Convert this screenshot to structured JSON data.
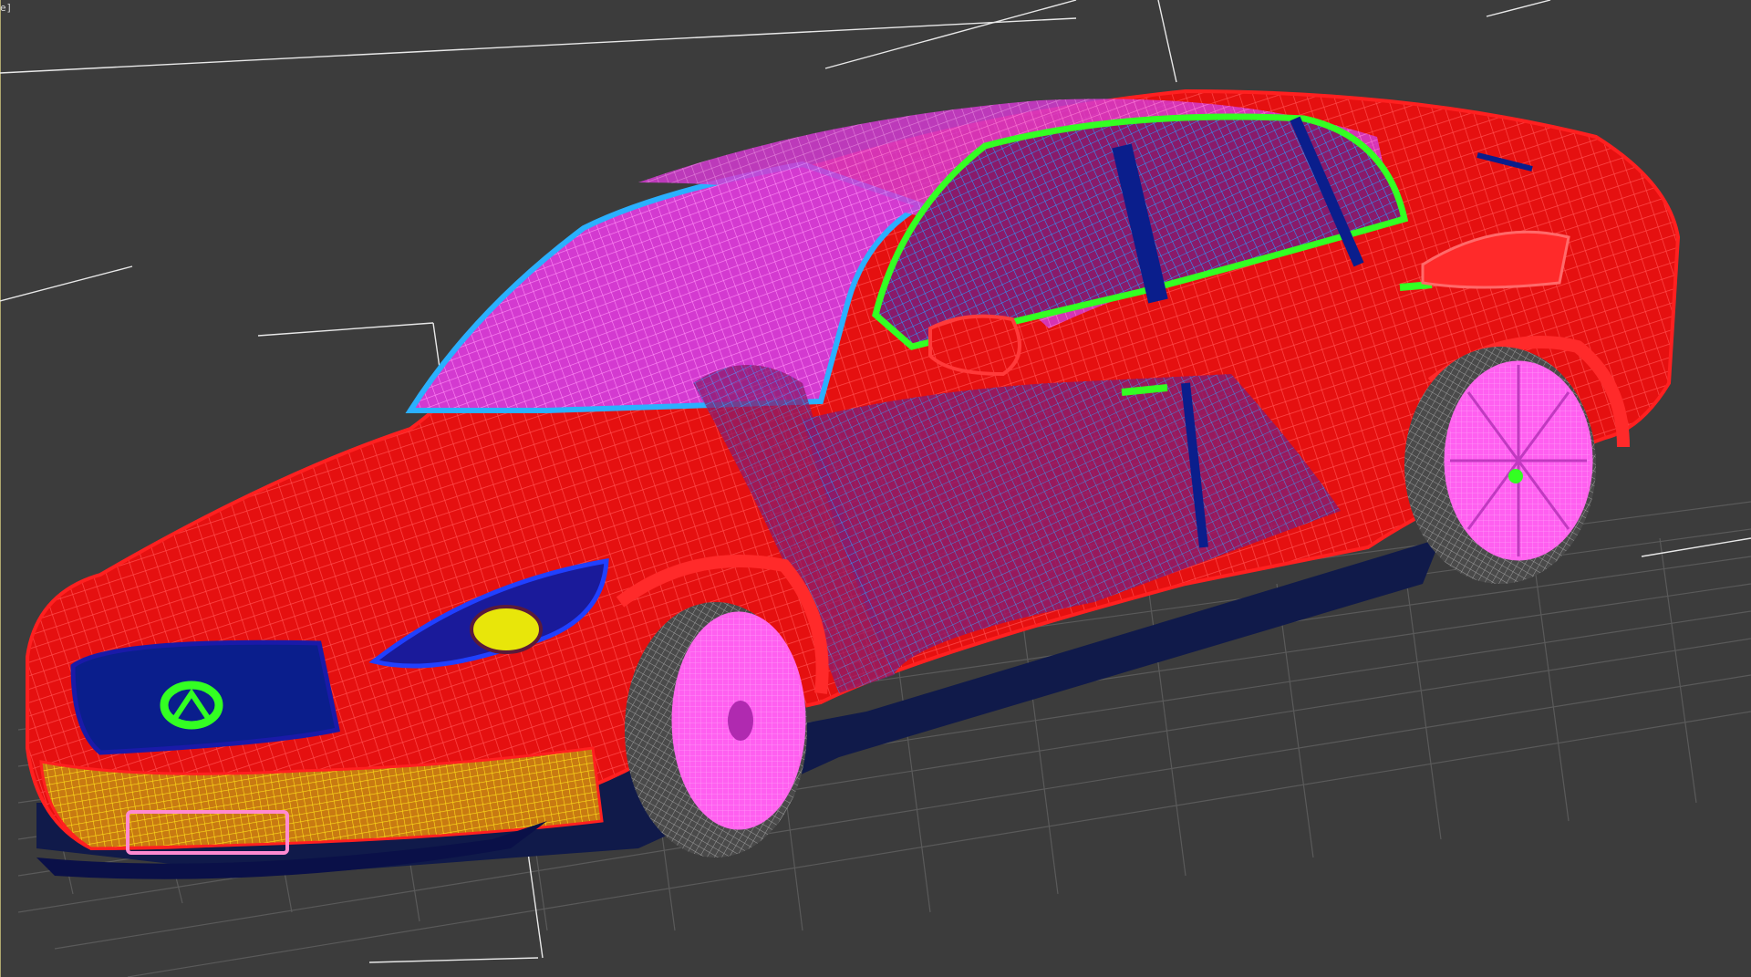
{
  "viewport": {
    "label": "e]",
    "background": "#3c3c3c",
    "content": "wireframe-sedan",
    "colors": {
      "body": "#ff1a1a",
      "glass": "#ff66ee",
      "trim": "#1fa8ff",
      "window_line": "#33ff22",
      "grille": "#0a1e8c",
      "wheels": "#ff66ee",
      "tire": "#8a8a8a",
      "bumper": "#ffd21a",
      "grid": "#5c5c5c"
    }
  }
}
